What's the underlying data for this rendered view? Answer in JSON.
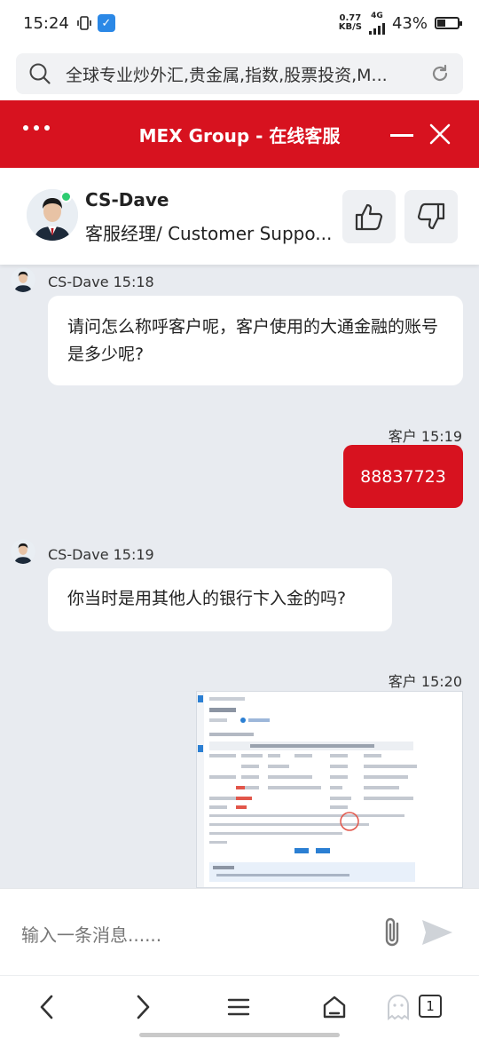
{
  "status_bar": {
    "time": "15:24",
    "net_speed_value": "0.77",
    "net_speed_unit": "KB/S",
    "network": "4G",
    "battery": "43%",
    "battery_level": 0.43
  },
  "browser": {
    "url_text": "全球专业炒外汇,贵金属,指数,股票投资,M...",
    "tab_count": "1"
  },
  "header": {
    "title": "MEX Group - 在线客服"
  },
  "agent": {
    "name": "CS-Dave",
    "role": "客服经理/ Customer Suppo..."
  },
  "messages": [
    {
      "sender": "CS-Dave",
      "time": "15:18",
      "meta": "CS-Dave 15:18",
      "text": "请问怎么称呼客户呢，客户使用的大通金融的账号是多少呢?"
    },
    {
      "sender": "客户",
      "time": "15:19",
      "meta": "客户 15:19",
      "text": "88837723"
    },
    {
      "sender": "CS-Dave",
      "time": "15:19",
      "meta": "CS-Dave 15:19",
      "text": "你当时是用其他人的银行卞入金的吗?"
    },
    {
      "sender": "客户",
      "time": "15:20",
      "meta": "客户 15:20",
      "text": ""
    }
  ],
  "composer": {
    "placeholder": "输入一条消息......"
  },
  "colors": {
    "brand_red": "#d7121f",
    "chat_bg": "#e8ebf0",
    "online_green": "#2ecc71"
  },
  "icons": {
    "search": "search-icon",
    "refresh": "refresh-icon",
    "menu": "more-dots-icon",
    "minimize": "minimize-icon",
    "close": "close-icon",
    "like": "thumbs-up-icon",
    "dislike": "thumbs-down-icon",
    "attach": "paperclip-icon",
    "send": "send-icon",
    "back": "back-arrow-icon",
    "forward": "forward-arrow-icon",
    "browser_menu": "hamburger-menu-icon",
    "home": "home-icon",
    "ghost": "incognito-icon"
  }
}
